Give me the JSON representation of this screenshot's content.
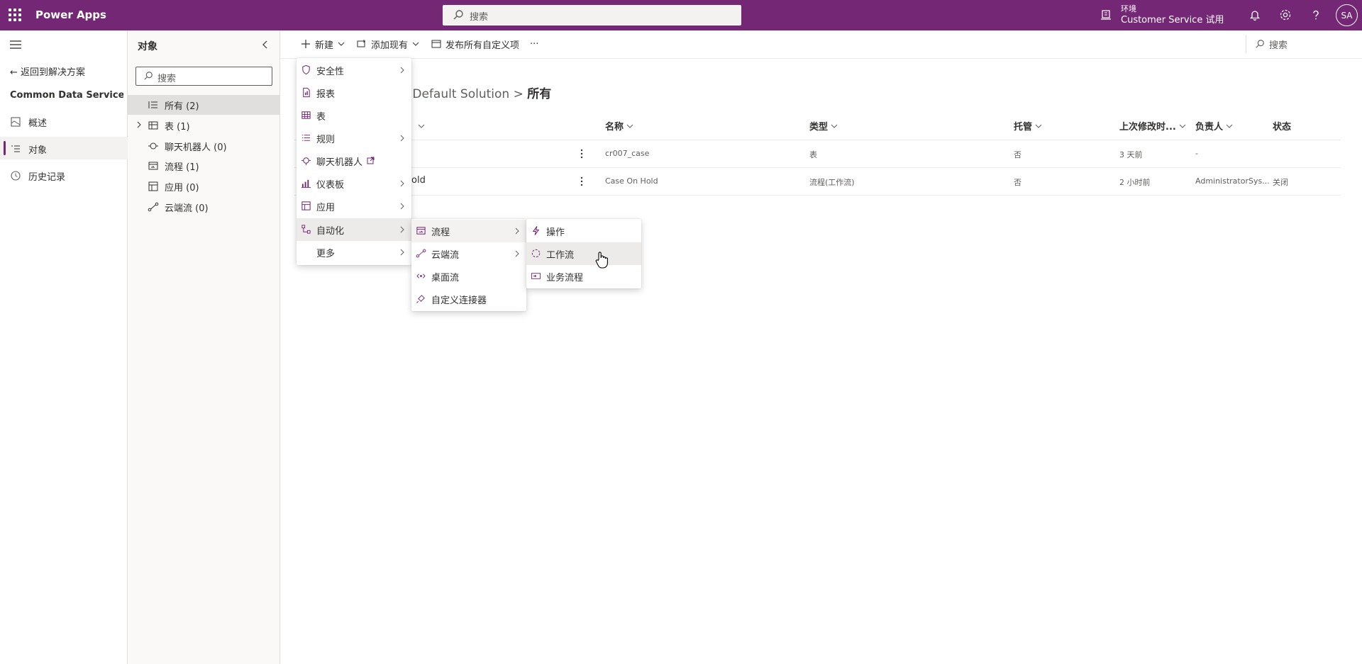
{
  "app": {
    "title": "Power Apps"
  },
  "topbar": {
    "search_placeholder": "搜索",
    "env_label": "环境",
    "env_name": "Customer Service 试用",
    "avatar_initials": "SA"
  },
  "leftrail": {
    "back_label": "返回到解决方案",
    "solution_name": "Common Data Services ...",
    "items": [
      {
        "label": "概述",
        "icon": "overview-icon"
      },
      {
        "label": "对象",
        "icon": "objects-icon"
      },
      {
        "label": "历史记录",
        "icon": "history-icon"
      }
    ]
  },
  "objects_panel": {
    "title": "对象",
    "search_placeholder": "搜索",
    "items": [
      {
        "label": "所有 (2)",
        "icon": "list-icon"
      },
      {
        "label": "表 (1)",
        "icon": "table-icon"
      },
      {
        "label": "聊天机器人 (0)",
        "icon": "bot-icon"
      },
      {
        "label": "流程 (1)",
        "icon": "process-icon"
      },
      {
        "label": "应用 (0)",
        "icon": "app-icon"
      },
      {
        "label": "云端流 (0)",
        "icon": "cloudflow-icon"
      }
    ]
  },
  "commandbar": {
    "new_label": "新建",
    "add_existing_label": "添加现有",
    "publish_label": "发布所有自定义项",
    "more_label": "···",
    "search_placeholder": "搜索"
  },
  "breadcrumb": {
    "parent": "tes Default Solution",
    "separator": ">",
    "current": "所有"
  },
  "table": {
    "columns": [
      "名称",
      "类型",
      "托管",
      "上次修改时...",
      "负责人",
      "状态"
    ],
    "rows": [
      {
        "display": "",
        "name": "cr007_case",
        "type": "表",
        "managed": "否",
        "modified": "3 天前",
        "owner": "-",
        "status": ""
      },
      {
        "display": "old",
        "name": "Case On Hold",
        "type": "流程(工作流)",
        "managed": "否",
        "modified": "2 小时前",
        "owner": "AdministratorSys...",
        "status": "关闭"
      }
    ]
  },
  "menu_new": {
    "items": [
      {
        "label": "安全性",
        "icon": "shield-icon",
        "submenu": true
      },
      {
        "label": "报表",
        "icon": "report-icon",
        "submenu": false
      },
      {
        "label": "表",
        "icon": "table-icon",
        "submenu": false
      },
      {
        "label": "规则",
        "icon": "rules-icon",
        "submenu": true
      },
      {
        "label": "聊天机器人",
        "icon": "bot-icon",
        "submenu": false,
        "external": true
      },
      {
        "label": "仪表板",
        "icon": "dashboard-icon",
        "submenu": true
      },
      {
        "label": "应用",
        "icon": "app-icon",
        "submenu": true
      },
      {
        "label": "自动化",
        "icon": "automation-icon",
        "submenu": true
      },
      {
        "label": "更多",
        "icon": "",
        "submenu": true
      }
    ]
  },
  "menu_automation": {
    "items": [
      {
        "label": "流程",
        "icon": "process-icon",
        "submenu": true
      },
      {
        "label": "云端流",
        "icon": "cloudflow-icon",
        "submenu": true
      },
      {
        "label": "桌面流",
        "icon": "desktopflow-icon",
        "submenu": false
      },
      {
        "label": "自定义连接器",
        "icon": "connector-icon",
        "submenu": false
      }
    ]
  },
  "menu_process": {
    "items": [
      {
        "label": "操作",
        "icon": "action-icon"
      },
      {
        "label": "工作流",
        "icon": "workflow-icon"
      },
      {
        "label": "业务流程",
        "icon": "bpf-icon"
      }
    ]
  },
  "colors": {
    "brand": "#742774",
    "accent": "#742774"
  }
}
